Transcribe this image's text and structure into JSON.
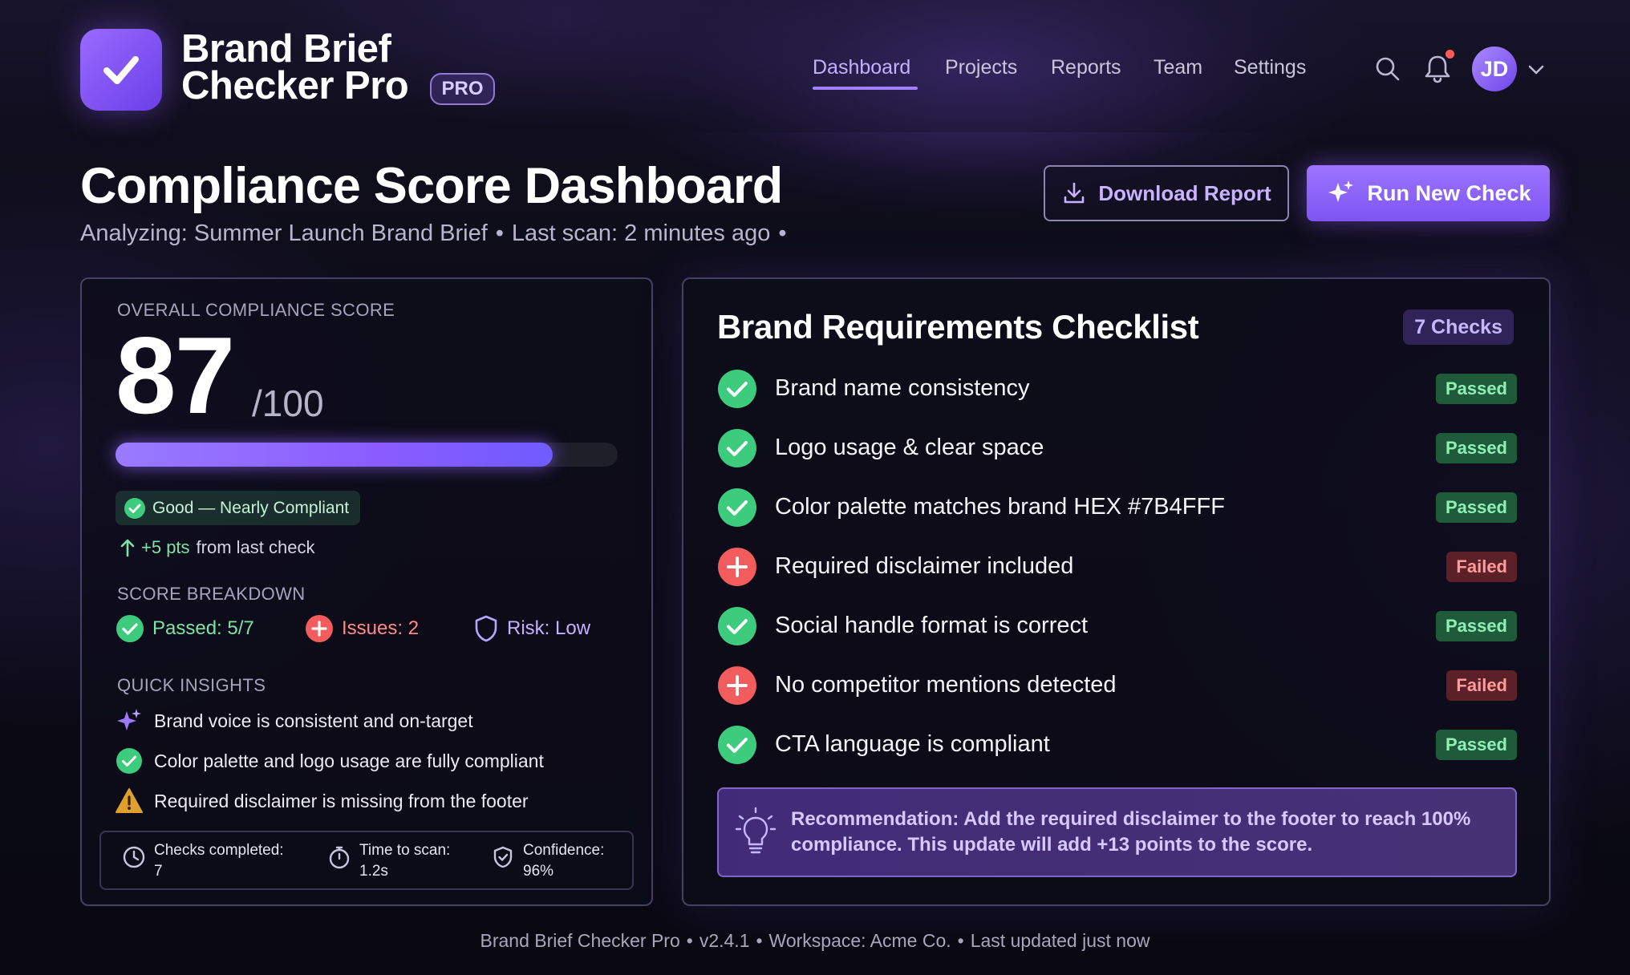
{
  "app": {
    "name_line1": "Brand Brief",
    "name_line2": "Checker Pro",
    "plan_badge": "PRO"
  },
  "nav": {
    "items": [
      {
        "label": "Dashboard",
        "active": true
      },
      {
        "label": "Projects",
        "active": false
      },
      {
        "label": "Reports",
        "active": false
      },
      {
        "label": "Team",
        "active": false
      },
      {
        "label": "Settings",
        "active": false
      }
    ]
  },
  "user": {
    "initials": "JD",
    "has_notification": true
  },
  "page": {
    "title": "Compliance Score Dashboard",
    "subtitle_analyzing": "Analyzing: Summer Launch Brand Brief",
    "subtitle_last_scan": "Last scan: 2 minutes ago",
    "download_label": "Download Report",
    "run_label": "Run New Check"
  },
  "score": {
    "label": "OVERALL COMPLIANCE SCORE",
    "value": "87",
    "max": "/100",
    "progress_fraction": 0.87,
    "status": "Good — Nearly Compliant",
    "delta_pts": "+5 pts",
    "delta_suffix": "from last check",
    "breakdown_label": "SCORE BREAKDOWN",
    "passed": "Passed: 5/7",
    "issues": "Issues: 2",
    "risk": "Risk: Low",
    "insights_label": "QUICK INSIGHTS",
    "insights": [
      {
        "icon": "sparkle-icon",
        "text": "Brand voice is consistent and on-target"
      },
      {
        "icon": "check-circle-icon",
        "text": "Color palette and logo usage are fully compliant"
      },
      {
        "icon": "warning-icon",
        "text": "Required disclaimer is missing from the footer"
      }
    ],
    "stats": [
      {
        "icon": "clock-icon",
        "label": "Checks completed:",
        "value": "7"
      },
      {
        "icon": "stopwatch-icon",
        "label": "Time to scan:",
        "value": "1.2s"
      },
      {
        "icon": "shield-check-icon",
        "label": "Confidence:",
        "value": "96%"
      }
    ]
  },
  "checklist": {
    "title": "Brand Requirements Checklist",
    "count_label": "7 Checks",
    "items": [
      {
        "label": "Brand name consistency",
        "status": "Passed"
      },
      {
        "label": "Logo usage & clear space",
        "status": "Passed"
      },
      {
        "label": "Color palette matches brand HEX #7B4FFF",
        "status": "Passed"
      },
      {
        "label": "Required disclaimer included",
        "status": "Failed"
      },
      {
        "label": "Social handle format is correct",
        "status": "Passed"
      },
      {
        "label": "No competitor mentions detected",
        "status": "Failed"
      },
      {
        "label": "CTA language is compliant",
        "status": "Passed"
      }
    ],
    "recommendation": "Recommendation: Add the required disclaimer to the footer to reach 100% compliance. This update will add +13 points to the score."
  },
  "footer": {
    "app": "Brand Brief Checker Pro",
    "version": "v2.4.1",
    "workspace": "Workspace: Acme Co.",
    "updated": "Last updated just now"
  },
  "colors": {
    "accent": "#9C74FF",
    "passed": "#3DCB7E",
    "failed": "#F25C5C",
    "warning": "#E0A030"
  }
}
